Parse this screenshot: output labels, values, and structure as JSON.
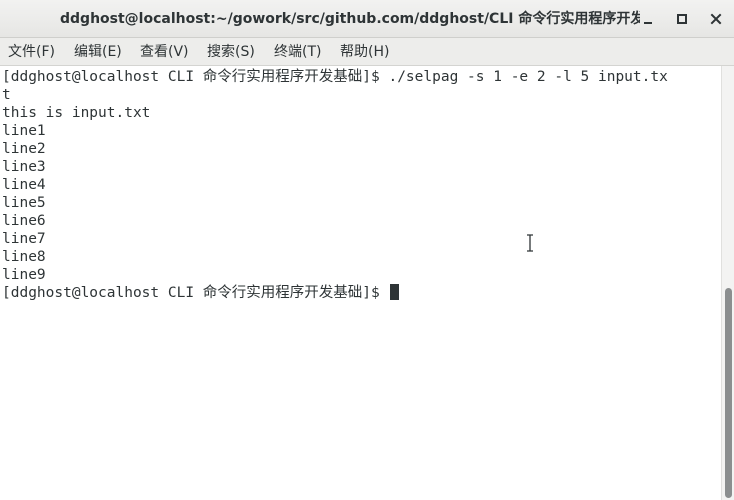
{
  "window": {
    "title": "ddghost@localhost:~/gowork/src/github.com/ddghost/CLI 命令行实用程序开发基础"
  },
  "controls": {
    "minimize_icon": "minimize-icon",
    "maximize_icon": "maximize-icon",
    "close_icon": "close-icon"
  },
  "menu": {
    "file": "文件(F)",
    "edit": "编辑(E)",
    "view": "查看(V)",
    "search": "搜索(S)",
    "terminal": "终端(T)",
    "help": "帮助(H)"
  },
  "terminal": {
    "lines": [
      "[ddghost@localhost CLI 命令行实用程序开发基础]$ ./selpag -s 1 -e 2 -l 5 input.tx",
      "t",
      "this is input.txt",
      "line1",
      "line2",
      "line3",
      "line4",
      "line5",
      "line6",
      "line7",
      "line8",
      "line9",
      "[ddghost@localhost CLI 命令行实用程序开发基础]$ "
    ]
  },
  "colors": {
    "text": "#2e3436",
    "background": "#ffffff",
    "scroll_thumb": "#8b8e8f"
  }
}
